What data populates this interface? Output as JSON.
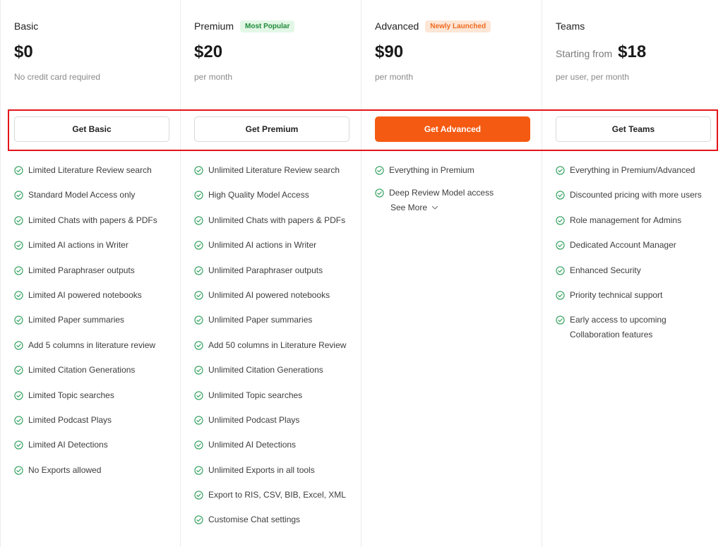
{
  "plans": [
    {
      "name": "Basic",
      "badge": "",
      "price_prefix": "",
      "price": "$0",
      "price_note": "No credit card required",
      "cta": "Get Basic",
      "features": [
        "Limited Literature Review search",
        "Standard Model Access only",
        "Limited Chats with papers & PDFs",
        "Limited AI actions in Writer",
        "Limited Paraphraser outputs",
        "Limited AI powered notebooks",
        "Limited Paper summaries",
        "Add 5 columns in literature review",
        "Limited Citation Generations",
        "Limited Topic searches",
        "Limited Podcast Plays",
        "Limited AI Detections",
        "No Exports allowed"
      ]
    },
    {
      "name": "Premium",
      "badge": "Most Popular",
      "price_prefix": "",
      "price": "$20",
      "price_note": "per month",
      "cta": "Get Premium",
      "features": [
        "Unlimited Literature Review search",
        "High Quality Model Access",
        "Unlimited Chats with papers & PDFs",
        "Unlimited AI actions in Writer",
        "Unlimited Paraphraser outputs",
        "Unlimited AI powered notebooks",
        "Unlimited Paper summaries",
        "Add 50 columns in Literature Review",
        "Unlimited Citation Generations",
        "Unlimited Topic searches",
        "Unlimited Podcast Plays",
        "Unlimited AI Detections",
        "Unlimited Exports in all tools",
        "Export to RIS, CSV, BIB, Excel, XML",
        "Customise Chat settings"
      ]
    },
    {
      "name": "Advanced",
      "badge": "Newly Launched",
      "price_prefix": "",
      "price": "$90",
      "price_note": "per month",
      "cta": "Get Advanced",
      "features": [
        "Everything in Premium",
        "Deep Review Model access"
      ],
      "see_more": "See More"
    },
    {
      "name": "Teams",
      "badge": "",
      "price_prefix": "Starting from",
      "price": "$18",
      "price_note": "per user, per month",
      "cta": "Get Teams",
      "features": [
        "Everything in Premium/Advanced",
        "Discounted pricing with more users",
        "Role management for Admins",
        "Dedicated Account Manager",
        "Enhanced Security",
        "Priority technical support",
        "Early access to upcoming Collaboration features"
      ]
    }
  ],
  "colors": {
    "accent": "#f55a12",
    "check": "#2e9e5b",
    "highlight": "#e3151b",
    "badge_green_bg": "#e3f7e6",
    "badge_green_text": "#1f8a3b",
    "badge_orange_bg": "#fde6d6",
    "badge_orange_text": "#f06a1f"
  },
  "icons": {
    "feature": "check-circle-icon",
    "see_more": "chevron-down-icon"
  }
}
